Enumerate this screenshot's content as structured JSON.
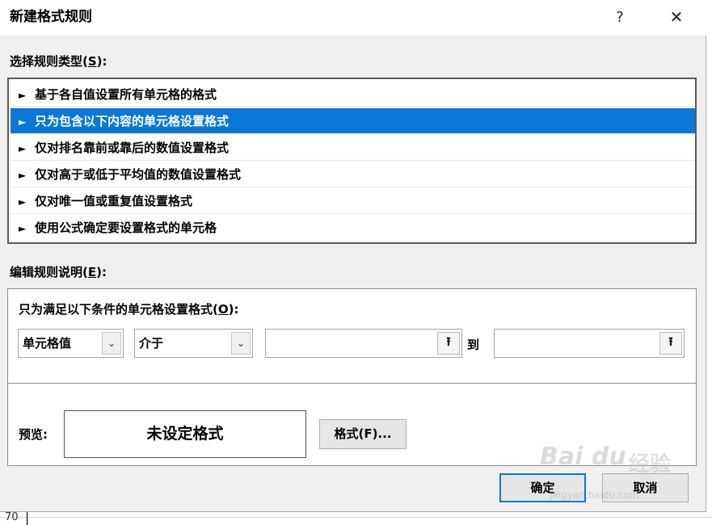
{
  "dialog": {
    "title": "新建格式规则",
    "help_glyph": "?",
    "close_glyph": "✕"
  },
  "rule_type": {
    "label_prefix": "选择规则类型(",
    "label_key": "S",
    "label_suffix": "):",
    "items": [
      {
        "label": "基于各自值设置所有单元格的格式",
        "selected": false
      },
      {
        "label": "只为包含以下内容的单元格设置格式",
        "selected": true
      },
      {
        "label": "仅对排名靠前或靠后的数值设置格式",
        "selected": false
      },
      {
        "label": "仅对高于或低于平均值的数值设置格式",
        "selected": false
      },
      {
        "label": "仅对唯一值或重复值设置格式",
        "selected": false
      },
      {
        "label": "使用公式确定要设置格式的单元格",
        "selected": false
      }
    ],
    "arrow_glyph": "►"
  },
  "edit_rule": {
    "label_prefix": "编辑规则说明(",
    "label_key": "E",
    "label_suffix": "):",
    "condition_prefix": "只为满足以下条件的单元格设置格式(",
    "condition_key": "O",
    "condition_suffix": "):",
    "field_select": "单元格值",
    "operator_select": "介于",
    "value1": "",
    "to_label": "到",
    "value2": "",
    "collapse_glyph": "⭱",
    "dropdown_glyph": "⌄",
    "preview_label": "预览:",
    "preview_text": "未设定格式",
    "format_button": "格式(F)..."
  },
  "footer": {
    "ok_button": "确定",
    "cancel_button": "取消"
  },
  "background": {
    "row_number": "70"
  },
  "watermark": {
    "logo": "Bai du",
    "text": "经验",
    "url": "jingyan.baidu.com"
  },
  "colors": {
    "selection": "#0c78d6",
    "dialog_bg": "#f0f0f0"
  }
}
